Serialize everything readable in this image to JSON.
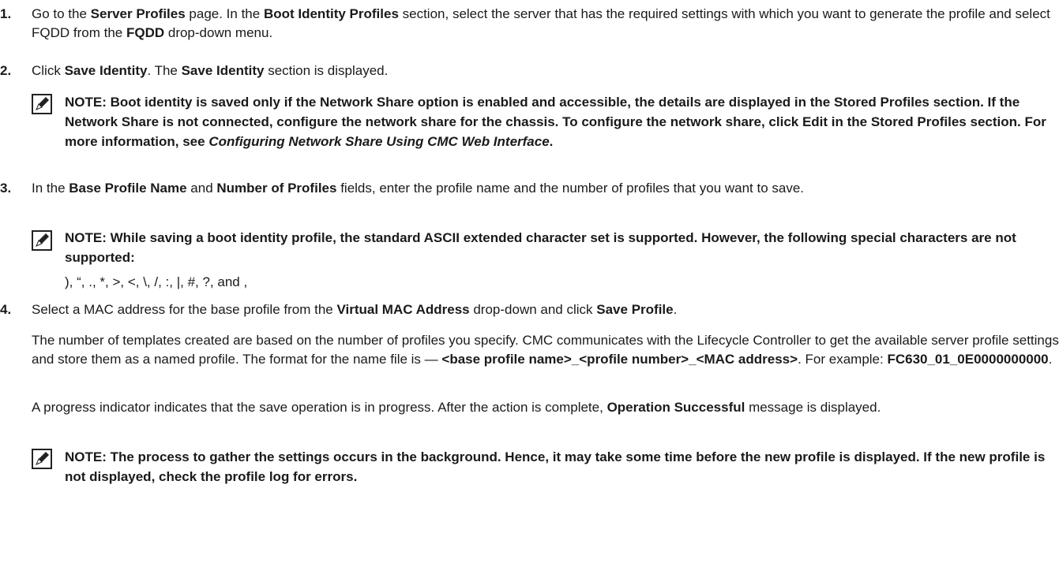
{
  "steps": {
    "s1": {
      "number": "1.",
      "t1": "Go to the ",
      "b1": "Server Profiles",
      "t2": " page. In the ",
      "b2": "Boot Identity Profiles",
      "t3": " section, select the server that has the required settings with which you want to generate the profile and select FQDD from the ",
      "b3": "FQDD",
      "t4": " drop-down menu."
    },
    "s2": {
      "number": "2.",
      "t1": "Click ",
      "b1": "Save Identity",
      "t2": ". The ",
      "b2": "Save Identity",
      "t3": " section is displayed."
    },
    "s3": {
      "number": "3.",
      "t1": "In the ",
      "b1": "Base Profile Name",
      "t2": " and ",
      "b2": "Number of Profiles",
      "t3": " fields, enter the profile name and the number of profiles that you want to save."
    },
    "s4": {
      "number": "4.",
      "t1": "Select a MAC address for the base profile from the ",
      "b1": "Virtual MAC Address",
      "t2": " drop-down and click ",
      "b2": "Save Profile",
      "t3": "."
    }
  },
  "notes": {
    "n1": {
      "text": "NOTE: Boot identity is saved only if the Network Share option is enabled and accessible, the details are displayed in the Stored Profiles section. If the Network Share is not connected, configure the network share for the chassis. To configure the network share, click Edit in the Stored Profiles section. For more information, see ",
      "italic": "Configuring Network Share Using CMC Web Interface",
      "end": "."
    },
    "n2": {
      "text": "NOTE: While saving a boot identity profile, the standard ASCII extended character set is supported. However, the following special characters are not supported:"
    },
    "n3": {
      "text": "NOTE: The process to gather the settings occurs in the background. Hence, it may take some time before the new profile is displayed. If the new profile is not displayed, check the profile log for errors."
    }
  },
  "special_chars": "), “, ., *, >, <, \\, /, :, |, #, ?, and ,",
  "paragraphs": {
    "p1": {
      "t1": "The number of templates created are based on the number of profiles you specify. CMC communicates with the Lifecycle Controller to get the available server profile settings and store them as a named profile. The format for the name file is — ",
      "b1": "<base profile name>_<profile number>_<MAC address>",
      "t2": ". For example: ",
      "b2": "FC630_01_0E0000000000",
      "t3": "."
    },
    "p2": {
      "t1": "A progress indicator indicates that the save operation is in progress. After the action is complete, ",
      "b1": "Operation Successful",
      "t2": " message is displayed."
    }
  },
  "icons": {
    "note": "pencil-note-icon"
  }
}
